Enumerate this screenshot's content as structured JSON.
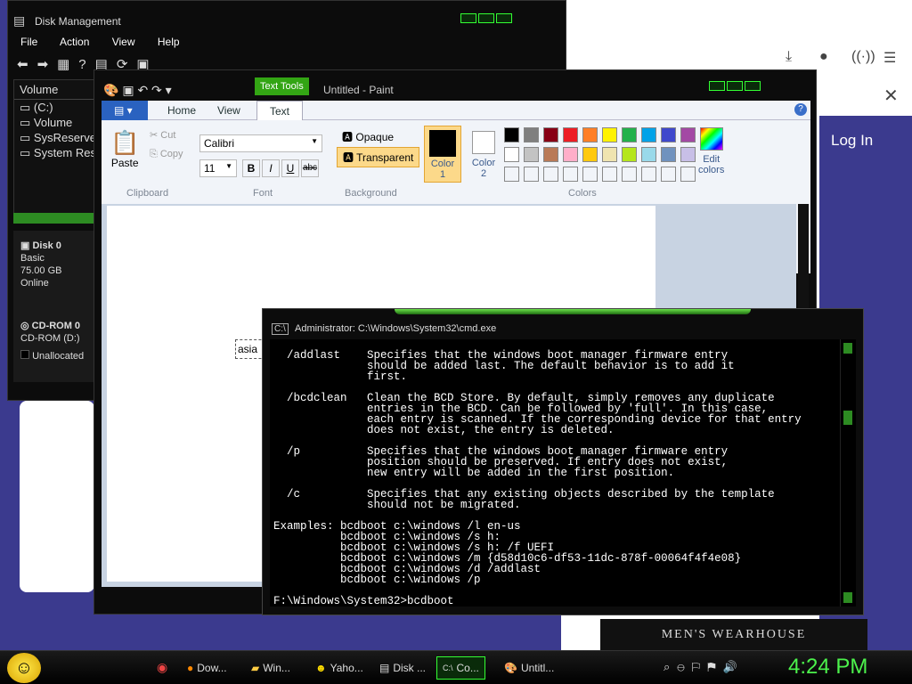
{
  "browser": {
    "login": "Log In",
    "brand": "MEN'S WEARHOUSE"
  },
  "disk_management": {
    "title": "Disk Management",
    "menu": [
      "File",
      "Action",
      "View",
      "Help"
    ],
    "volume_header": "Volume",
    "volumes": [
      "(C:)",
      "Volume",
      "SysReserve",
      "System Res"
    ],
    "disk0": {
      "name": "Disk 0",
      "type": "Basic",
      "size": "75.00 GB",
      "status": "Online"
    },
    "cdrom": {
      "name": "CD-ROM 0",
      "label": "CD-ROM (D:)"
    },
    "legend": "Unallocated"
  },
  "paint": {
    "title": "Untitled - Paint",
    "tools_tab": "Text Tools",
    "tabs": [
      "Home",
      "View",
      "Text"
    ],
    "clipboard": {
      "paste": "Paste",
      "cut": "Cut",
      "copy": "Copy",
      "label": "Clipboard"
    },
    "font": {
      "family": "Calibri",
      "size": "11",
      "label": "Font"
    },
    "background": {
      "opaque": "Opaque",
      "transparent": "Transparent",
      "label": "Background"
    },
    "colors": {
      "color1_a": "Color",
      "color1_b": "1",
      "color2_a": "Color",
      "color2_b": "2",
      "edit_a": "Edit",
      "edit_b": "colors",
      "label": "Colors"
    },
    "palette": [
      "#000000",
      "#7f7f7f",
      "#880015",
      "#ed1c24",
      "#ff7f27",
      "#fff200",
      "#22b14c",
      "#00a2e8",
      "#3f48cc",
      "#a349a4",
      "#ffffff",
      "#c3c3c3",
      "#b97a57",
      "#ffaec9",
      "#ffc90e",
      "#efe4b0",
      "#b5e61d",
      "#99d9ea",
      "#7092be",
      "#c8bfe7"
    ],
    "canvas_text": "asia"
  },
  "cmd": {
    "title": "Administrator: C:\\Windows\\System32\\cmd.exe",
    "body": "  /addlast    Specifies that the windows boot manager firmware entry\n              should be added last. The default behavior is to add it\n              first.\n\n  /bcdclean   Clean the BCD Store. By default, simply removes any duplicate\n              entries in the BCD. Can be followed by 'full'. In this case,\n              each entry is scanned. If the corresponding device for that entry\n              does not exist, the entry is deleted.\n\n  /p          Specifies that the windows boot manager firmware entry\n              position should be preserved. If entry does not exist,\n              new entry will be added in the first position.\n\n  /c          Specifies that any existing objects described by the template\n              should not be migrated.\n\nExamples: bcdboot c:\\windows /l en-us\n          bcdboot c:\\windows /s h:\n          bcdboot c:\\windows /s h: /f UEFI\n          bcdboot c:\\windows /m {d58d10c6-df53-11dc-878f-00064f4f4e08}\n          bcdboot c:\\windows /d /addlast\n          bcdboot c:\\windows /p\n\nF:\\Windows\\System32>bcdboot"
  },
  "taskbar": {
    "tasks": [
      "Dow...",
      "Win...",
      "Yaho...",
      "Disk ...",
      "Co...",
      "Untitl..."
    ],
    "clock": "4:24 PM"
  }
}
